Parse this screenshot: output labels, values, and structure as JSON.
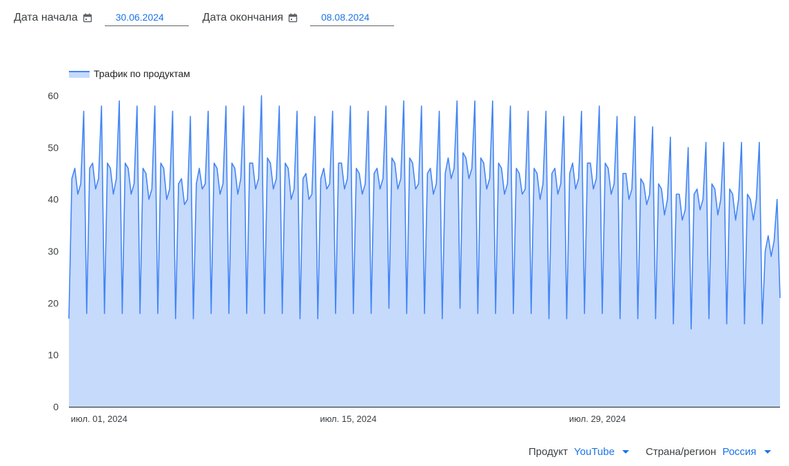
{
  "filters_top": {
    "start": {
      "label": "Дата начала",
      "value": "30.06.2024"
    },
    "end": {
      "label": "Дата окончания",
      "value": "08.08.2024"
    }
  },
  "filters_bottom": {
    "product": {
      "label": "Продукт",
      "value": "YouTube"
    },
    "region": {
      "label": "Страна/регион",
      "value": "Россия"
    }
  },
  "colors": {
    "line": "#4285f4",
    "fill": "#c6dafc",
    "accent": "#1a73e8",
    "axis": "#202124"
  },
  "chart_data": {
    "type": "area",
    "legend": {
      "label": "Трафик по продуктам",
      "position": "top-left"
    },
    "ylim": [
      0,
      60
    ],
    "yticks": [
      0,
      10,
      20,
      30,
      40,
      50,
      60
    ],
    "xticks": [
      {
        "date": "2024-07-01",
        "label": "июл. 01, 2024"
      },
      {
        "date": "2024-07-15",
        "label": "июл. 15, 2024"
      },
      {
        "date": "2024-07-29",
        "label": "июл. 29, 2024"
      }
    ],
    "x_start": "2024-06-30T00:00",
    "x_end": "2024-08-08T23:00",
    "grid": false,
    "values": [
      17,
      44,
      46,
      41,
      43,
      57,
      18,
      46,
      47,
      42,
      44,
      58,
      18,
      47,
      46,
      41,
      44,
      59,
      18,
      47,
      46,
      41,
      43,
      58,
      18,
      46,
      45,
      40,
      42,
      58,
      18,
      47,
      46,
      40,
      42,
      57,
      17,
      43,
      44,
      39,
      40,
      56,
      17,
      43,
      46,
      42,
      43,
      57,
      18,
      47,
      46,
      41,
      43,
      58,
      18,
      47,
      46,
      41,
      44,
      58,
      18,
      47,
      47,
      42,
      44,
      60,
      18,
      48,
      47,
      42,
      44,
      58,
      18,
      47,
      46,
      40,
      42,
      57,
      17,
      44,
      45,
      40,
      41,
      56,
      17,
      44,
      46,
      42,
      43,
      57,
      18,
      47,
      47,
      42,
      44,
      58,
      18,
      46,
      45,
      41,
      43,
      57,
      18,
      45,
      46,
      42,
      44,
      58,
      19,
      48,
      47,
      42,
      44,
      59,
      18,
      48,
      47,
      42,
      43,
      58,
      18,
      45,
      46,
      41,
      43,
      57,
      17,
      45,
      48,
      44,
      46,
      59,
      19,
      49,
      48,
      44,
      46,
      59,
      18,
      48,
      47,
      42,
      44,
      59,
      18,
      47,
      46,
      41,
      43,
      58,
      18,
      46,
      45,
      41,
      42,
      57,
      18,
      46,
      45,
      40,
      43,
      57,
      17,
      45,
      46,
      41,
      43,
      56,
      17,
      45,
      47,
      42,
      44,
      57,
      18,
      47,
      47,
      42,
      44,
      58,
      18,
      47,
      46,
      41,
      43,
      56,
      17,
      45,
      45,
      40,
      42,
      56,
      17,
      44,
      43,
      39,
      41,
      54,
      17,
      43,
      42,
      37,
      40,
      52,
      16,
      41,
      41,
      36,
      38,
      50,
      15,
      41,
      42,
      38,
      40,
      51,
      17,
      43,
      42,
      37,
      40,
      51,
      16,
      42,
      41,
      36,
      40,
      51,
      16,
      41,
      40,
      36,
      40,
      51,
      16,
      30,
      33,
      29,
      32,
      40,
      21
    ]
  }
}
